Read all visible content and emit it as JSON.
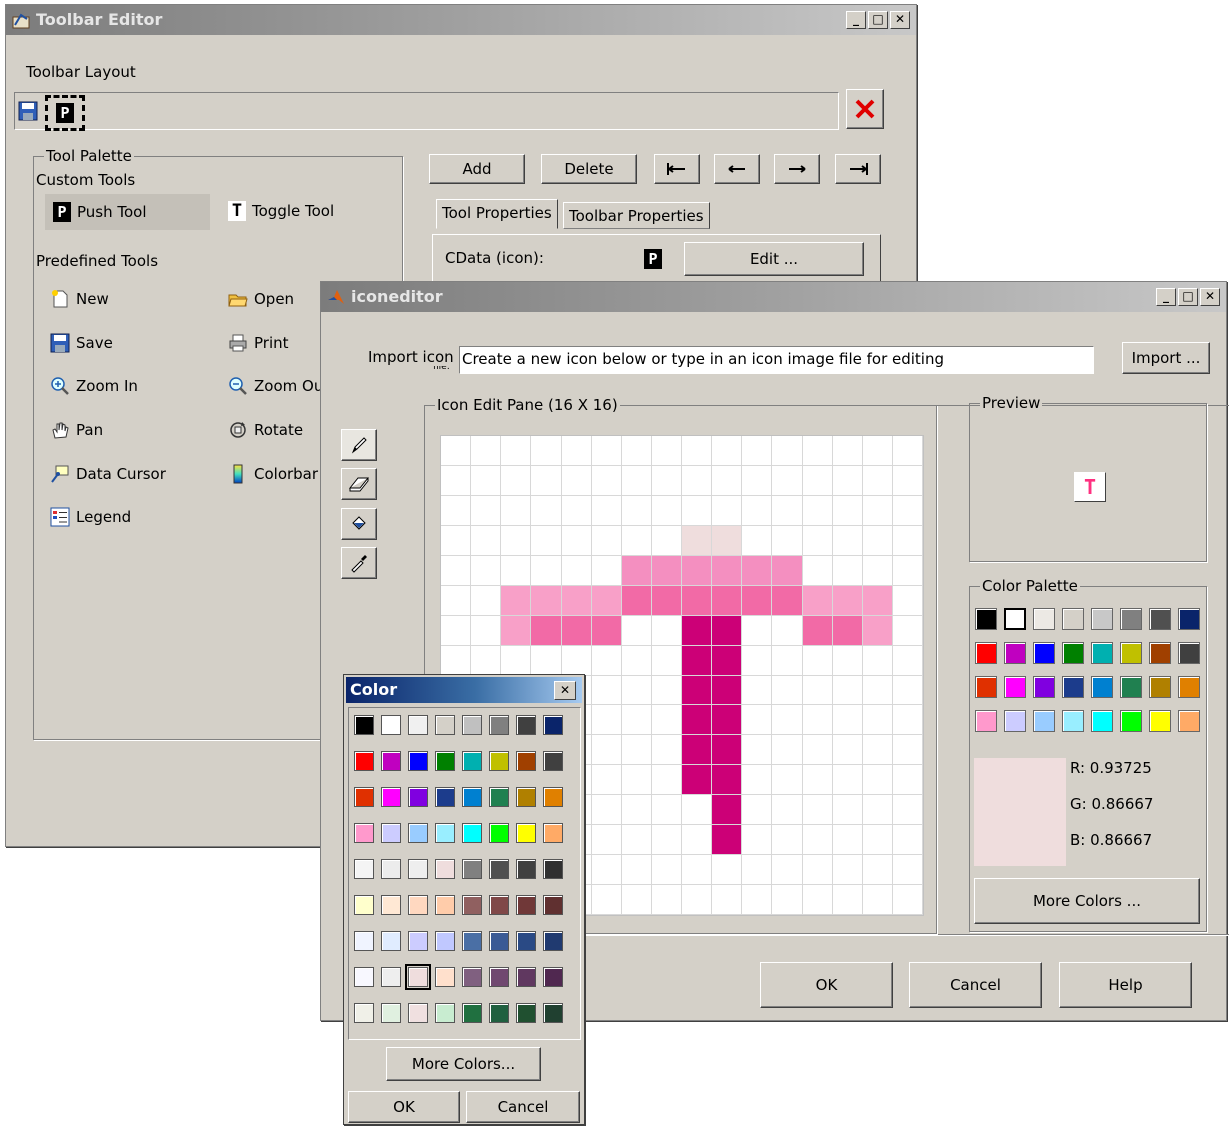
{
  "toolbar_editor": {
    "title": "Toolbar Editor",
    "layout_label": "Toolbar Layout",
    "palette_label": "Tool Palette",
    "custom_label": "Custom Tools",
    "push_tool": "Push Tool",
    "toggle_tool": "Toggle Tool",
    "predefined_label": "Predefined Tools",
    "predefined": [
      "New",
      "Open",
      "Save",
      "Print",
      "Zoom In",
      "Zoom Ou",
      "Pan",
      "Rotate",
      "Data Cursor",
      "Colorbar",
      "Legend"
    ],
    "add": "Add",
    "delete": "Delete",
    "tab_tool": "Tool Properties",
    "tab_toolbar": "Toolbar Properties",
    "cdata_label": "CData (icon):",
    "edit": "Edit ...",
    "p_glyph": "P",
    "t_glyph": "T"
  },
  "icon_editor": {
    "title": "iconeditor",
    "import_label": "Import icon",
    "import_label2": "file:",
    "import_value": "Create a new icon below or type in an icon image file for editing",
    "import_button": "Import ...",
    "edit_pane_label": "Icon Edit Pane (16 X 16)",
    "preview_label": "Preview",
    "preview_glyph": "T",
    "palette_label": "Color Palette",
    "r": "R: 0.93725",
    "g": "G: 0.86667",
    "b": "B: 0.86667",
    "more_colors": "More Colors ...",
    "ok": "OK",
    "cancel": "Cancel",
    "help": "Help",
    "palette_colors": [
      "#000000",
      "#ffffff",
      "#ece9e4",
      "#d4d0c8",
      "#c8c8c8",
      "#808080",
      "#505050",
      "#0a246a",
      "#ff0000",
      "#c000c0",
      "#0000ff",
      "#008000",
      "#00b0b0",
      "#c0c000",
      "#a04000",
      "#404040",
      "#e03000",
      "#ff00ff",
      "#8000e0",
      "#1c3c8c",
      "#0080d0",
      "#208050",
      "#b08000",
      "#e08000",
      "#ff99cc",
      "#ccccff",
      "#99ccff",
      "#99eeff",
      "#00ffff",
      "#00ff00",
      "#ffff00",
      "#ffaa66"
    ],
    "selected_color": "#efdddd",
    "pixels": [
      {
        "r": 3,
        "c": 8,
        "color": "#efdddd"
      },
      {
        "r": 3,
        "c": 9,
        "color": "#efdddd"
      },
      {
        "r": 4,
        "c": 6,
        "color": "#f48fc0"
      },
      {
        "r": 4,
        "c": 7,
        "color": "#f48fc0"
      },
      {
        "r": 4,
        "c": 8,
        "color": "#f48fc0"
      },
      {
        "r": 4,
        "c": 9,
        "color": "#f48fc0"
      },
      {
        "r": 4,
        "c": 10,
        "color": "#f48fc0"
      },
      {
        "r": 4,
        "c": 11,
        "color": "#f48fc0"
      },
      {
        "r": 5,
        "c": 2,
        "color": "#f8a0c8"
      },
      {
        "r": 5,
        "c": 3,
        "color": "#f8a0c8"
      },
      {
        "r": 5,
        "c": 4,
        "color": "#f8a0c8"
      },
      {
        "r": 5,
        "c": 5,
        "color": "#f8a0c8"
      },
      {
        "r": 5,
        "c": 6,
        "color": "#f26aa6"
      },
      {
        "r": 5,
        "c": 7,
        "color": "#f26aa6"
      },
      {
        "r": 5,
        "c": 8,
        "color": "#f26aa6"
      },
      {
        "r": 5,
        "c": 9,
        "color": "#f26aa6"
      },
      {
        "r": 5,
        "c": 10,
        "color": "#f26aa6"
      },
      {
        "r": 5,
        "c": 11,
        "color": "#f26aa6"
      },
      {
        "r": 5,
        "c": 12,
        "color": "#f8a0c8"
      },
      {
        "r": 5,
        "c": 13,
        "color": "#f8a0c8"
      },
      {
        "r": 5,
        "c": 14,
        "color": "#f8a0c8"
      },
      {
        "r": 6,
        "c": 2,
        "color": "#f8a0c8"
      },
      {
        "r": 6,
        "c": 3,
        "color": "#f26aa6"
      },
      {
        "r": 6,
        "c": 4,
        "color": "#f26aa6"
      },
      {
        "r": 6,
        "c": 5,
        "color": "#f26aa6"
      },
      {
        "r": 6,
        "c": 8,
        "color": "#cc0077"
      },
      {
        "r": 6,
        "c": 9,
        "color": "#cc0077"
      },
      {
        "r": 6,
        "c": 12,
        "color": "#f26aa6"
      },
      {
        "r": 6,
        "c": 13,
        "color": "#f26aa6"
      },
      {
        "r": 6,
        "c": 14,
        "color": "#f8a0c8"
      },
      {
        "r": 7,
        "c": 8,
        "color": "#cc0077"
      },
      {
        "r": 7,
        "c": 9,
        "color": "#cc0077"
      },
      {
        "r": 8,
        "c": 8,
        "color": "#cc0077"
      },
      {
        "r": 8,
        "c": 9,
        "color": "#cc0077"
      },
      {
        "r": 9,
        "c": 8,
        "color": "#cc0077"
      },
      {
        "r": 9,
        "c": 9,
        "color": "#cc0077"
      },
      {
        "r": 10,
        "c": 8,
        "color": "#cc0077"
      },
      {
        "r": 10,
        "c": 9,
        "color": "#cc0077"
      },
      {
        "r": 11,
        "c": 8,
        "color": "#cc0077"
      },
      {
        "r": 11,
        "c": 9,
        "color": "#cc0077"
      },
      {
        "r": 12,
        "c": 9,
        "color": "#cc0077"
      },
      {
        "r": 13,
        "c": 9,
        "color": "#cc0077"
      }
    ]
  },
  "color_popup": {
    "title": "Color",
    "close": "✕",
    "more_colors": "More Colors...",
    "ok": "OK",
    "cancel": "Cancel",
    "colors": [
      "#000000",
      "#ffffff",
      "#f0f0f0",
      "#d4d0c8",
      "#c0c0c0",
      "#808080",
      "#404040",
      "#0a246a",
      "#ff0000",
      "#c000c0",
      "#0000ff",
      "#008000",
      "#00b0b0",
      "#c0c000",
      "#a04000",
      "#404040",
      "#e03000",
      "#ff00ff",
      "#8000e0",
      "#1c3c8c",
      "#0080d0",
      "#208050",
      "#b08000",
      "#e08000",
      "#ff99cc",
      "#ccccff",
      "#99ccff",
      "#99eeff",
      "#00ffff",
      "#00ff00",
      "#ffff00",
      "#ffaa66",
      "#f4f4f4",
      "#ececec",
      "#eeeeee",
      "#efdddd",
      "#808080",
      "#505050",
      "#404040",
      "#303030",
      "#ffffcc",
      "#ffe8d4",
      "#ffd8c0",
      "#ffccaa",
      "#906060",
      "#804848",
      "#703838",
      "#603030",
      "#f0f4ff",
      "#e0ecff",
      "#ccccff",
      "#c0c8ff",
      "#4a6fa5",
      "#3a5a95",
      "#2a4a85",
      "#203a70",
      "#f8f8ff",
      "#eeeeee",
      "#efdddd",
      "#ffe0cc",
      "#806080",
      "#704870",
      "#603860",
      "#502850",
      "#f0f0e8",
      "#e0f0e0",
      "#f0e0e0",
      "#c8ecd0",
      "#207040",
      "#206040",
      "#205030",
      "#204030"
    ]
  }
}
